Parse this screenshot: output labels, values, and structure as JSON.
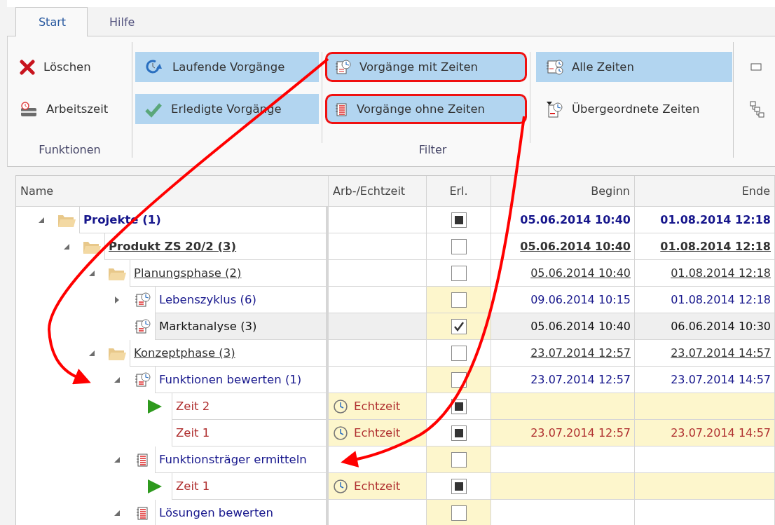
{
  "ribbon": {
    "tabs": [
      {
        "label": "Start",
        "selected": true
      },
      {
        "label": "Hilfe",
        "selected": false
      }
    ],
    "groups": [
      {
        "label": "Funktionen",
        "columns": [
          [
            {
              "kind": "delete",
              "label": "Löschen",
              "selected": false
            },
            {
              "kind": "worktime",
              "label": "Arbeitszeit",
              "selected": false
            }
          ]
        ]
      },
      {
        "label": "Filter",
        "columns": [
          [
            {
              "kind": "running",
              "label": "Laufende Vorgänge",
              "selected": true
            },
            {
              "kind": "done",
              "label": "Erledigte Vorgänge",
              "selected": true
            }
          ],
          [
            {
              "kind": "timed",
              "label": "Vorgänge mit Zeiten",
              "selected": true,
              "highlighted": true
            },
            {
              "kind": "untimed",
              "label": "Vorgänge ohne Zeiten",
              "selected": true,
              "highlighted": true
            }
          ],
          [
            {
              "kind": "all-times",
              "label": "Alle Zeiten",
              "selected": true
            },
            {
              "kind": "parent-times",
              "label": "Übergeordnete Zeiten",
              "selected": false
            }
          ]
        ]
      },
      {
        "columns": [
          [
            {
              "kind": "box",
              "selected": false
            },
            {
              "kind": "hierarchy",
              "selected": false
            }
          ]
        ]
      }
    ]
  },
  "grid": {
    "columns": [
      "Name",
      "Arb-/Echtzeit",
      "Erl.",
      "Beginn",
      "Ende"
    ],
    "tree": [
      {
        "kind": "folder",
        "name": "Projekte (1)",
        "expanded": true,
        "bold": true,
        "underline": false,
        "color": "#16168c",
        "selected": false,
        "checked": false,
        "indeterminate": true,
        "begin": "05.06.2014 10:40",
        "end": "01.08.2014 12:18",
        "children": [
          {
            "kind": "folder",
            "name": "Produkt ZS 20/2 (3)",
            "expanded": true,
            "bold": true,
            "underline": true,
            "color": "#333333",
            "selected": false,
            "checked": false,
            "indeterminate": false,
            "begin": "05.06.2014 10:40",
            "end": "01.08.2014 12:18",
            "children": [
              {
                "kind": "folder",
                "name": "Planungsphase (2)",
                "expanded": true,
                "bold": false,
                "underline": true,
                "color": "#333333",
                "selected": false,
                "checked": false,
                "indeterminate": false,
                "begin": "05.06.2014 10:40",
                "end": "01.08.2014 12:18",
                "children": [
                  {
                    "kind": "timed-task",
                    "name": "Lebenszyklus (6)",
                    "expanded": false,
                    "bold": false,
                    "underline": false,
                    "color": "#16168c",
                    "selected": false,
                    "checked": false,
                    "indeterminate": false,
                    "begin": "09.06.2014 10:15",
                    "end": "01.08.2014 12:18"
                  },
                  {
                    "kind": "timed-task",
                    "name": "Marktanalyse (3)",
                    "bold": false,
                    "underline": false,
                    "color": "#111111",
                    "selected": true,
                    "checked": true,
                    "indeterminate": false,
                    "begin": "05.06.2014 10:40",
                    "end": "06.06.2014 10:30"
                  }
                ]
              },
              {
                "kind": "folder",
                "name": "Konzeptphase (3)",
                "expanded": true,
                "bold": false,
                "underline": true,
                "color": "#333333",
                "selected": false,
                "checked": false,
                "indeterminate": false,
                "begin": "23.07.2014 12:57",
                "end": "23.07.2014 14:57",
                "children": [
                  {
                    "kind": "timed-task",
                    "name": "Funktionen bewerten (1)",
                    "expanded": true,
                    "bold": false,
                    "underline": false,
                    "color": "#16168c",
                    "selected": false,
                    "checked": false,
                    "indeterminate": false,
                    "begin": "23.07.2014 12:57",
                    "end": "23.07.2014 14:57",
                    "children": [
                      {
                        "kind": "time",
                        "name": "Zeit 2",
                        "running": true,
                        "bold": false,
                        "underline": false,
                        "color": "#b03030",
                        "selected": false,
                        "time_type": "Echtzeit",
                        "checked": false,
                        "indeterminate": true
                      },
                      {
                        "kind": "time",
                        "name": "Zeit 1",
                        "running": false,
                        "bold": false,
                        "underline": false,
                        "color": "#b03030",
                        "selected": false,
                        "time_type": "Echtzeit",
                        "checked": false,
                        "indeterminate": true,
                        "begin": "23.07.2014 12:57",
                        "end": "23.07.2014 14:57"
                      }
                    ]
                  },
                  {
                    "kind": "task",
                    "name": "Funktionsträger ermitteln",
                    "expanded": true,
                    "bold": false,
                    "underline": false,
                    "color": "#16168c",
                    "selected": false,
                    "checked": false,
                    "indeterminate": false,
                    "children": [
                      {
                        "kind": "time",
                        "name": "Zeit 1",
                        "running": true,
                        "bold": false,
                        "underline": false,
                        "color": "#b03030",
                        "selected": false,
                        "time_type": "Echtzeit",
                        "checked": false,
                        "indeterminate": true
                      }
                    ]
                  },
                  {
                    "kind": "task",
                    "name": "Lösungen bewerten",
                    "expanded": true,
                    "bold": false,
                    "underline": false,
                    "color": "#16168c",
                    "selected": false,
                    "checked": false,
                    "indeterminate": false
                  }
                ]
              }
            ]
          }
        ]
      }
    ]
  }
}
